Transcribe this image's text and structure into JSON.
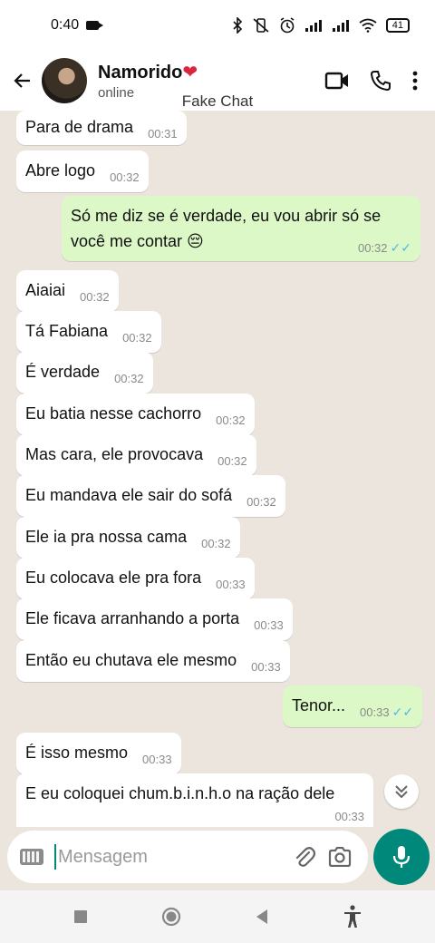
{
  "status_bar": {
    "time": "0:40",
    "battery": "41"
  },
  "header": {
    "contact_name": "Namorido",
    "contact_emoji": "❤",
    "contact_status": "online",
    "overlay_label": "Fake Chat"
  },
  "messages": [
    {
      "side": "in",
      "text": "Para de drama",
      "time": "00:31"
    },
    {
      "side": "in",
      "text": "Abre logo",
      "time": "00:32"
    },
    {
      "side": "out",
      "text": "Só me diz se é verdade, eu vou abrir só se",
      "text2": "você me contar 😔",
      "time": "00:32",
      "read": true
    },
    {
      "side": "in",
      "text": "Aiaiai",
      "time": "00:32"
    },
    {
      "side": "in",
      "text": "Tá Fabiana",
      "time": "00:32"
    },
    {
      "side": "in",
      "text": "É verdade",
      "time": "00:32"
    },
    {
      "side": "in",
      "text": "Eu batia nesse cachorro",
      "time": "00:32"
    },
    {
      "side": "in",
      "text": "Mas cara, ele provocava",
      "time": "00:32"
    },
    {
      "side": "in",
      "text": "Eu mandava ele sair do sofá",
      "time": "00:32"
    },
    {
      "side": "in",
      "text": "Ele ia pra nossa cama",
      "time": "00:32"
    },
    {
      "side": "in",
      "text": "Eu colocava ele pra fora",
      "time": "00:33"
    },
    {
      "side": "in",
      "text": "Ele ficava arranhando a porta",
      "time": "00:33"
    },
    {
      "side": "in",
      "text": "Então eu chutava ele mesmo",
      "time": "00:33"
    },
    {
      "side": "out",
      "text": "Tenor...",
      "time": "00:33",
      "read": true
    },
    {
      "side": "in",
      "text": "É isso mesmo",
      "time": "00:33"
    },
    {
      "side": "in",
      "text": "E eu coloquei chum.b.i.n.h.o na ração dele",
      "time": "00:33"
    }
  ],
  "composer": {
    "placeholder": "Mensagem"
  },
  "colors": {
    "accent": "#00897b",
    "out_bubble": "#dcf8c6",
    "in_bubble": "#ffffff",
    "chat_bg": "#ece5dd",
    "read_ticks": "#4fb6ec"
  },
  "icons": [
    "back-arrow-icon",
    "video-call-icon",
    "phone-icon",
    "more-vert-icon",
    "chevron-down-double-icon",
    "keyboard-icon",
    "attach-icon",
    "camera-icon",
    "mic-icon",
    "nav-square-icon",
    "nav-circle-icon",
    "nav-back-icon",
    "accessibility-icon"
  ]
}
